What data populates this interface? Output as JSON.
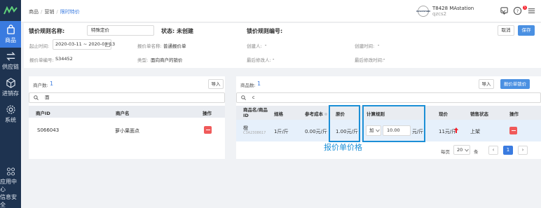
{
  "sidebar": {
    "items": [
      {
        "label": "商品",
        "icon": "bag-icon"
      },
      {
        "label": "供应链",
        "icon": "exchange-icon"
      },
      {
        "label": "进销存",
        "icon": "box-icon"
      },
      {
        "label": "系统",
        "icon": "gear-icon"
      },
      {
        "label": "应用中心",
        "icon": "apps-icon"
      },
      {
        "label": "信息安全",
        "icon": "shield-icon"
      }
    ]
  },
  "breadcrumb": {
    "items": [
      "商品",
      "营销"
    ],
    "current": "限时特价"
  },
  "user": {
    "avatar_text": "MASTATION",
    "name": "T8428 MAstation",
    "sub": "qzcs2",
    "notifications": "5"
  },
  "form": {
    "name_label": "锁价规则名称:",
    "name_value": "特殊定价",
    "status_label": "状态:",
    "status_value": "未创建",
    "rule_no_label": "锁价规则编号:",
    "cancel": "取消",
    "save": "保存",
    "period_label": "起止时间:",
    "period_value": "2020-03-11 ~ 2020-03-13",
    "quote_name_label": "报价单名称:",
    "quote_name_value": "普通报价单",
    "creator_label": "创建人:",
    "creator_value": "-",
    "created_time_label": "创建时间:",
    "created_time_value": "-",
    "quote_no_label": "报价单编号:",
    "quote_no_value": "S34452",
    "type_label": "类型:",
    "type_value": "面向商户的锁价",
    "modifier_label": "最后修改人:",
    "modifier_value": "-",
    "modified_time_label": "最后修改时间:",
    "modified_time_value": "-"
  },
  "merchants": {
    "count_label": "商户数:",
    "count": "1",
    "import": "导入",
    "search_value": "面",
    "columns": [
      "商户ID",
      "商户名",
      "操作"
    ],
    "rows": [
      {
        "id": "S066043",
        "name": "萝小果面点"
      }
    ]
  },
  "products": {
    "count_label": "商品数:",
    "count": "1",
    "import": "导入",
    "import_quote": "报价单锁价",
    "search_value": "c",
    "columns": [
      "商品名/商品ID",
      "规格",
      "参考成本",
      "原价",
      "计算规则",
      "现价",
      "销售状态",
      "操作"
    ],
    "rows": [
      {
        "name": "橙",
        "id": "C3A2308617",
        "spec": "1斤/斤",
        "cost": "0.00元/斤",
        "price": "1.00元/斤",
        "rule_op": "加",
        "rule_value": "10.00",
        "rule_unit": "元/斤",
        "final_price": "11元/斤",
        "status": "上架"
      }
    ],
    "annotation": "报价单价格",
    "page_label": "每页",
    "page_size": "20",
    "page_unit": "条",
    "current_page": "1"
  }
}
